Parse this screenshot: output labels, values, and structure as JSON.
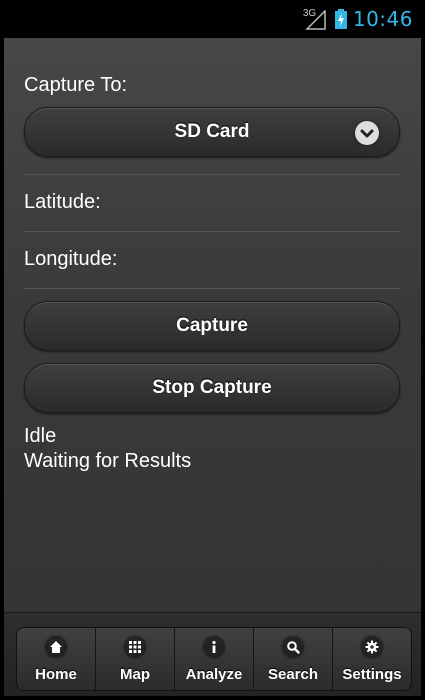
{
  "statusbar": {
    "network": "3G",
    "time": "10:46",
    "accent": "#33b5e5"
  },
  "form": {
    "capture_to_label": "Capture To:",
    "capture_to_value": "SD Card",
    "latitude_label": "Latitude:",
    "longitude_label": "Longitude:",
    "capture_button": "Capture",
    "stop_button": "Stop Capture",
    "status_line1": "Idle",
    "status_line2": "Waiting for Results"
  },
  "navbar": {
    "items": [
      {
        "label": "Home",
        "icon": "home-icon"
      },
      {
        "label": "Map",
        "icon": "grid-icon"
      },
      {
        "label": "Analyze",
        "icon": "info-icon"
      },
      {
        "label": "Search",
        "icon": "search-icon"
      },
      {
        "label": "Settings",
        "icon": "gear-icon"
      }
    ]
  }
}
